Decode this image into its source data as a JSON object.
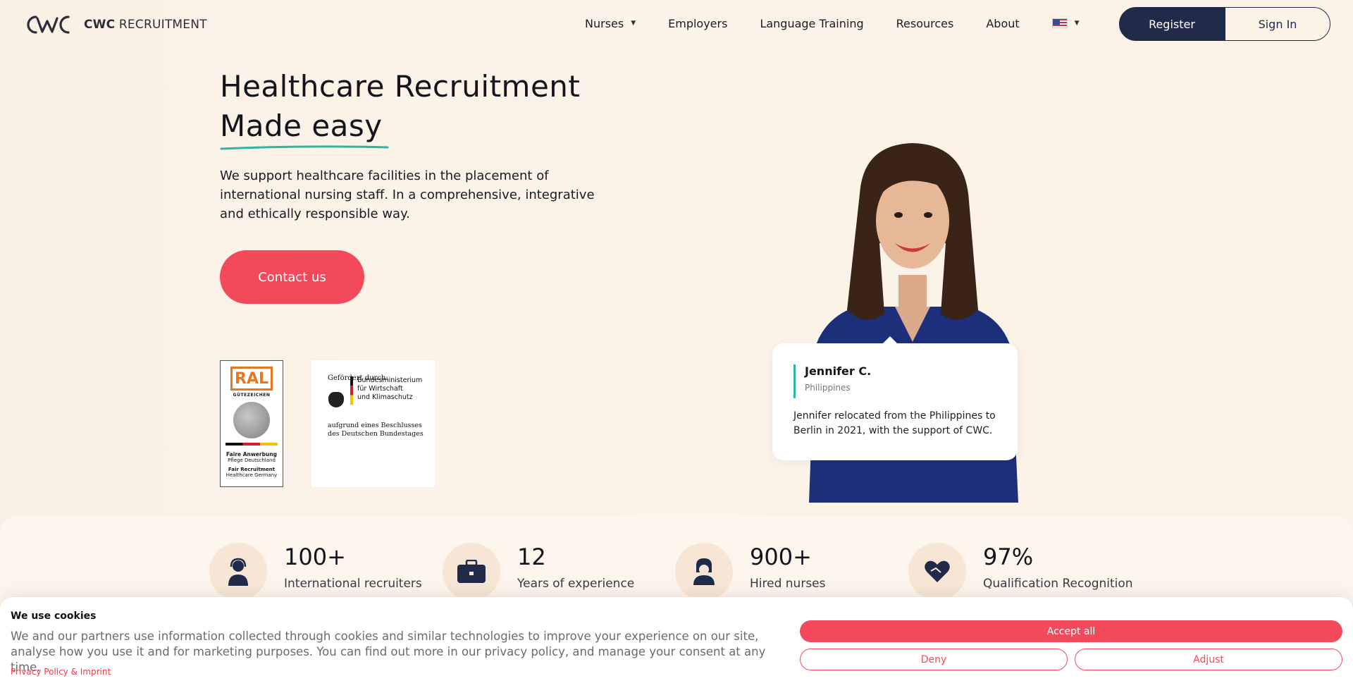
{
  "header": {
    "logo_brand": "CWC",
    "logo_word": "RECRUITMENT",
    "nav": [
      {
        "label": "Nurses",
        "has_caret": true
      },
      {
        "label": "Employers"
      },
      {
        "label": "Language Training"
      },
      {
        "label": "Resources"
      },
      {
        "label": "About"
      }
    ],
    "language_icon": "us-flag-icon",
    "register_label": "Register",
    "signin_label": "Sign In"
  },
  "hero": {
    "title_line1": "Healthcare Recruitment",
    "title_line2": "Made easy",
    "description": "We support healthcare facilities in the placement of international nursing staff. In a comprehensive, integrative and ethically responsible way.",
    "cta_label": "Contact us"
  },
  "badges": {
    "ral": {
      "mark": "RAL",
      "sub": "GÜTEZEICHEN",
      "line1": "Faire Anwerbung",
      "line2": "Pflege Deutschland",
      "line3": "Fair Recruitment",
      "line4": "Healthcare Germany"
    },
    "bmwk": {
      "top": "Gefördert durch:",
      "ministry_1": "Bundesministerium",
      "ministry_2": "für Wirtschaft",
      "ministry_3": "und Klimaschutz",
      "bottom_1": "aufgrund eines Beschlusses",
      "bottom_2": "des Deutschen Bundestages"
    }
  },
  "testimonial": {
    "name": "Jennifer C.",
    "country": "Philippines",
    "text": "Jennifer relocated from the Philippines to Berlin in 2021, with the support of CWC."
  },
  "stats": [
    {
      "value": "100+",
      "label": "International recruiters",
      "icon": "recruiter-headset-icon"
    },
    {
      "value": "12",
      "label": "Years of experience",
      "icon": "briefcase-icon"
    },
    {
      "value": "900+",
      "label": "Hired nurses",
      "icon": "nurse-icon"
    },
    {
      "value": "97%",
      "label": "Qualification Recognition",
      "icon": "heart-handshake-icon"
    }
  ],
  "cookie": {
    "title": "We use cookies",
    "text": "We and our partners use information collected through cookies and similar technologies to improve your experience on our site, analyse how you use it and for marketing purposes. You can find out more in our privacy policy, and manage your consent at any time.",
    "link": "Privacy Policy & Imprint",
    "accept_label": "Accept all",
    "deny_label": "Deny",
    "adjust_label": "Adjust"
  },
  "colors": {
    "accent": "#f24a5b",
    "navy": "#222a4a",
    "teal": "#2fb5a2",
    "background": "#fcf2e6"
  }
}
